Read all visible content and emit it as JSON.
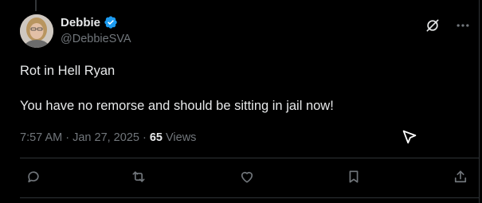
{
  "author": {
    "display_name": "Debbie",
    "handle": "@DebbieSVA",
    "verified": true
  },
  "tweet": {
    "paragraphs": [
      "Rot in Hell Ryan",
      "You have no remorse and should be sitting in jail now!"
    ],
    "time": "7:57 AM",
    "date": "Jan 27, 2025",
    "views_count": "65",
    "views_label": "Views",
    "separator": " · "
  },
  "icons": {
    "verified": "verified-badge-icon",
    "grok": "grok-icon",
    "more": "more-options-icon",
    "reply": "reply-icon",
    "repost": "repost-icon",
    "like": "like-icon",
    "bookmark": "bookmark-icon",
    "share": "share-icon",
    "cursor": "mouse-pointer-icon"
  },
  "colors": {
    "background": "#000000",
    "text_primary": "#e7e9ea",
    "text_secondary": "#71767b",
    "verified_blue": "#1d9bf0",
    "divider": "#2f3336"
  }
}
